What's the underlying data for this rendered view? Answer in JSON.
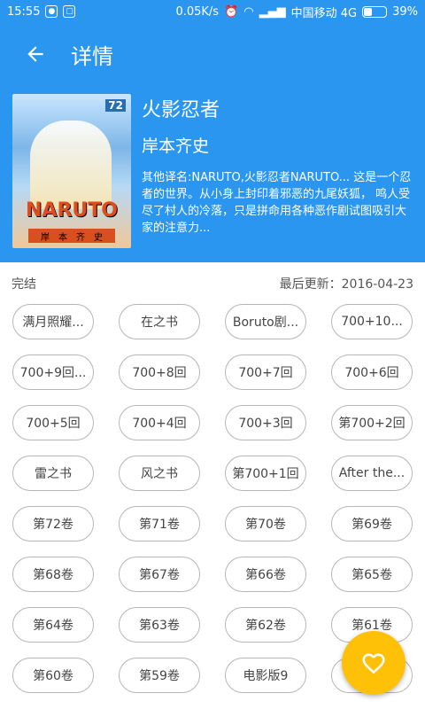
{
  "status_bar": {
    "time": "15:55",
    "network_speed": "0.05K/s",
    "carrier": "中国移动 4G",
    "battery": "39%",
    "battery_level": 0.39
  },
  "toolbar": {
    "title": "详情",
    "back_icon": "arrow-left-icon"
  },
  "manga": {
    "cover_number": "72",
    "cover_logo": "NARUTO",
    "cover_author_chars": [
      "岸",
      "本",
      "齐",
      "史"
    ],
    "title": "火影忍者",
    "author": "岸本齐史",
    "description": "其他译名:NARUTO,火影忍者NARUTO... 这是一个忍者的世界。从小身上封印着邪恶的九尾妖狐， 鸣人受尽了村人的冷落，只是拼命用各种恶作剧试图吸引大家的注意力..."
  },
  "meta": {
    "status": "完结",
    "updated": "最后更新：2016-04-23"
  },
  "chapters": [
    "满月照耀...",
    "在之书",
    "Boruto剧...",
    "700+10...",
    "700+9回...",
    "700+8回",
    "700+7回",
    "700+6回",
    "700+5回",
    "700+4回",
    "700+3回",
    "第700+2回",
    "雷之书",
    "风之书",
    "第700+1回",
    "After the...",
    "第72卷",
    "第71卷",
    "第70卷",
    "第69卷",
    "第68卷",
    "第67卷",
    "第66卷",
    "第65卷",
    "第64卷",
    "第63卷",
    "第62卷",
    "第61卷",
    "第60卷",
    "第59卷",
    "电影版9",
    ""
  ],
  "fab": {
    "icon": "heart-icon",
    "color": "#ffc107"
  },
  "colors": {
    "primary": "#2b96f0",
    "chip_border": "#b6b6b6"
  }
}
